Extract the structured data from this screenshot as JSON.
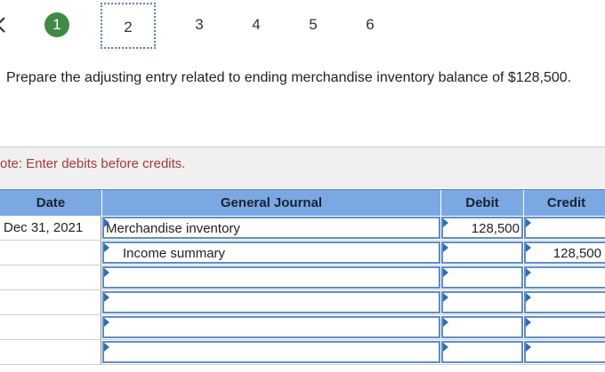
{
  "pager": {
    "back_icon": "chevron-left-icon",
    "steps": [
      "1",
      "2",
      "3",
      "4",
      "5",
      "6"
    ],
    "completed_step": "1",
    "current_step": "2"
  },
  "instruction": "Prepare the adjusting entry related to ending merchandise inventory balance of $128,500.",
  "note": "ote: Enter debits before credits.",
  "table": {
    "headers": {
      "date": "Date",
      "journal": "General Journal",
      "debit": "Debit",
      "credit": "Credit"
    },
    "rows": [
      {
        "date": "Dec 31, 2021",
        "account": "Merchandise inventory",
        "debit": "128,500",
        "credit": ""
      },
      {
        "date": "",
        "account": "Income summary",
        "debit": "",
        "credit": "128,500"
      },
      {
        "date": "",
        "account": "",
        "debit": "",
        "credit": ""
      },
      {
        "date": "",
        "account": "",
        "debit": "",
        "credit": ""
      },
      {
        "date": "",
        "account": "",
        "debit": "",
        "credit": ""
      },
      {
        "date": "",
        "account": "",
        "debit": "",
        "credit": ""
      }
    ]
  },
  "colors": {
    "header_bg": "#7ba8e2",
    "completed_step": "#3f8a45",
    "note_text": "#a43a3a",
    "input_border": "#5f8dc4"
  }
}
